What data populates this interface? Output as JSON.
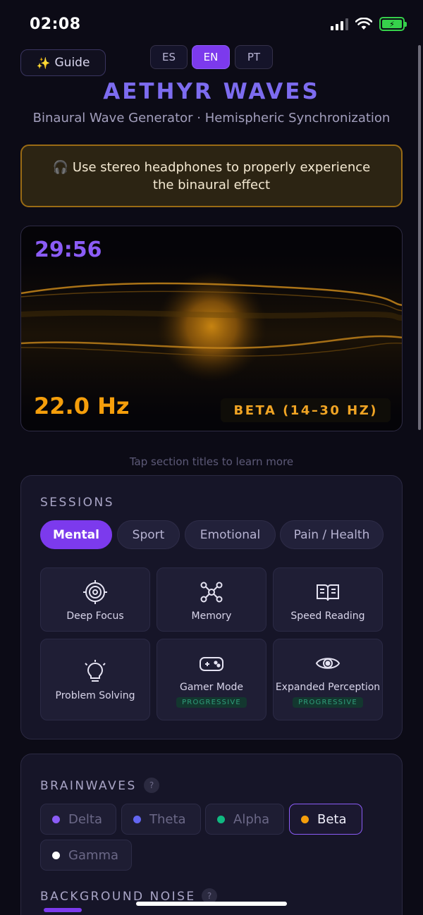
{
  "status": {
    "time": "02:08",
    "battery_icon": "battery-charging-icon",
    "wifi_icon": "wifi-icon",
    "signal_icon": "cellular-signal-icon"
  },
  "header": {
    "guide_label": "Guide",
    "guide_icon": "sparkles-icon",
    "languages": [
      "ES",
      "EN",
      "PT"
    ],
    "selected_language": "EN",
    "title": "AETHYR WAVES",
    "subtitle": "Binaural Wave Generator · Hemispheric Synchronization"
  },
  "warning": {
    "icon": "headphones-icon",
    "text": "🎧 Use stereo headphones to properly experience the binaural effect"
  },
  "visualizer": {
    "timer": "29:56",
    "frequency": "22.0 Hz",
    "band": "BETA (14–30 HZ)"
  },
  "hint": "Tap section titles to learn more",
  "sessions": {
    "title": "SESSIONS",
    "tabs": [
      "Mental",
      "Sport",
      "Emotional",
      "Pain / Health"
    ],
    "active_tab": "Mental",
    "cards": [
      {
        "label": "Deep Focus",
        "icon": "target-icon"
      },
      {
        "label": "Memory",
        "icon": "network-icon"
      },
      {
        "label": "Speed Reading",
        "icon": "book-icon"
      },
      {
        "label": "Problem Solving",
        "icon": "lightbulb-icon"
      },
      {
        "label": "Gamer Mode",
        "icon": "gamepad-icon",
        "badge": "PROGRESSIVE"
      },
      {
        "label": "Expanded Perception",
        "icon": "eye-icon",
        "badge": "PROGRESSIVE"
      }
    ]
  },
  "brainwaves": {
    "title": "BRAINWAVES",
    "help": "?",
    "options": [
      {
        "label": "Delta",
        "color": "#8b5cf6"
      },
      {
        "label": "Theta",
        "color": "#6366f1"
      },
      {
        "label": "Alpha",
        "color": "#10b981"
      },
      {
        "label": "Beta",
        "color": "#f59e0b"
      },
      {
        "label": "Gamma",
        "color": "#ffffff"
      }
    ],
    "selected": "Beta"
  },
  "noise": {
    "title": "BACKGROUND NOISE",
    "help": "?"
  },
  "colors": {
    "accent": "#7c3aed",
    "amber": "#f59e0b",
    "title": "#7d6cf0"
  }
}
